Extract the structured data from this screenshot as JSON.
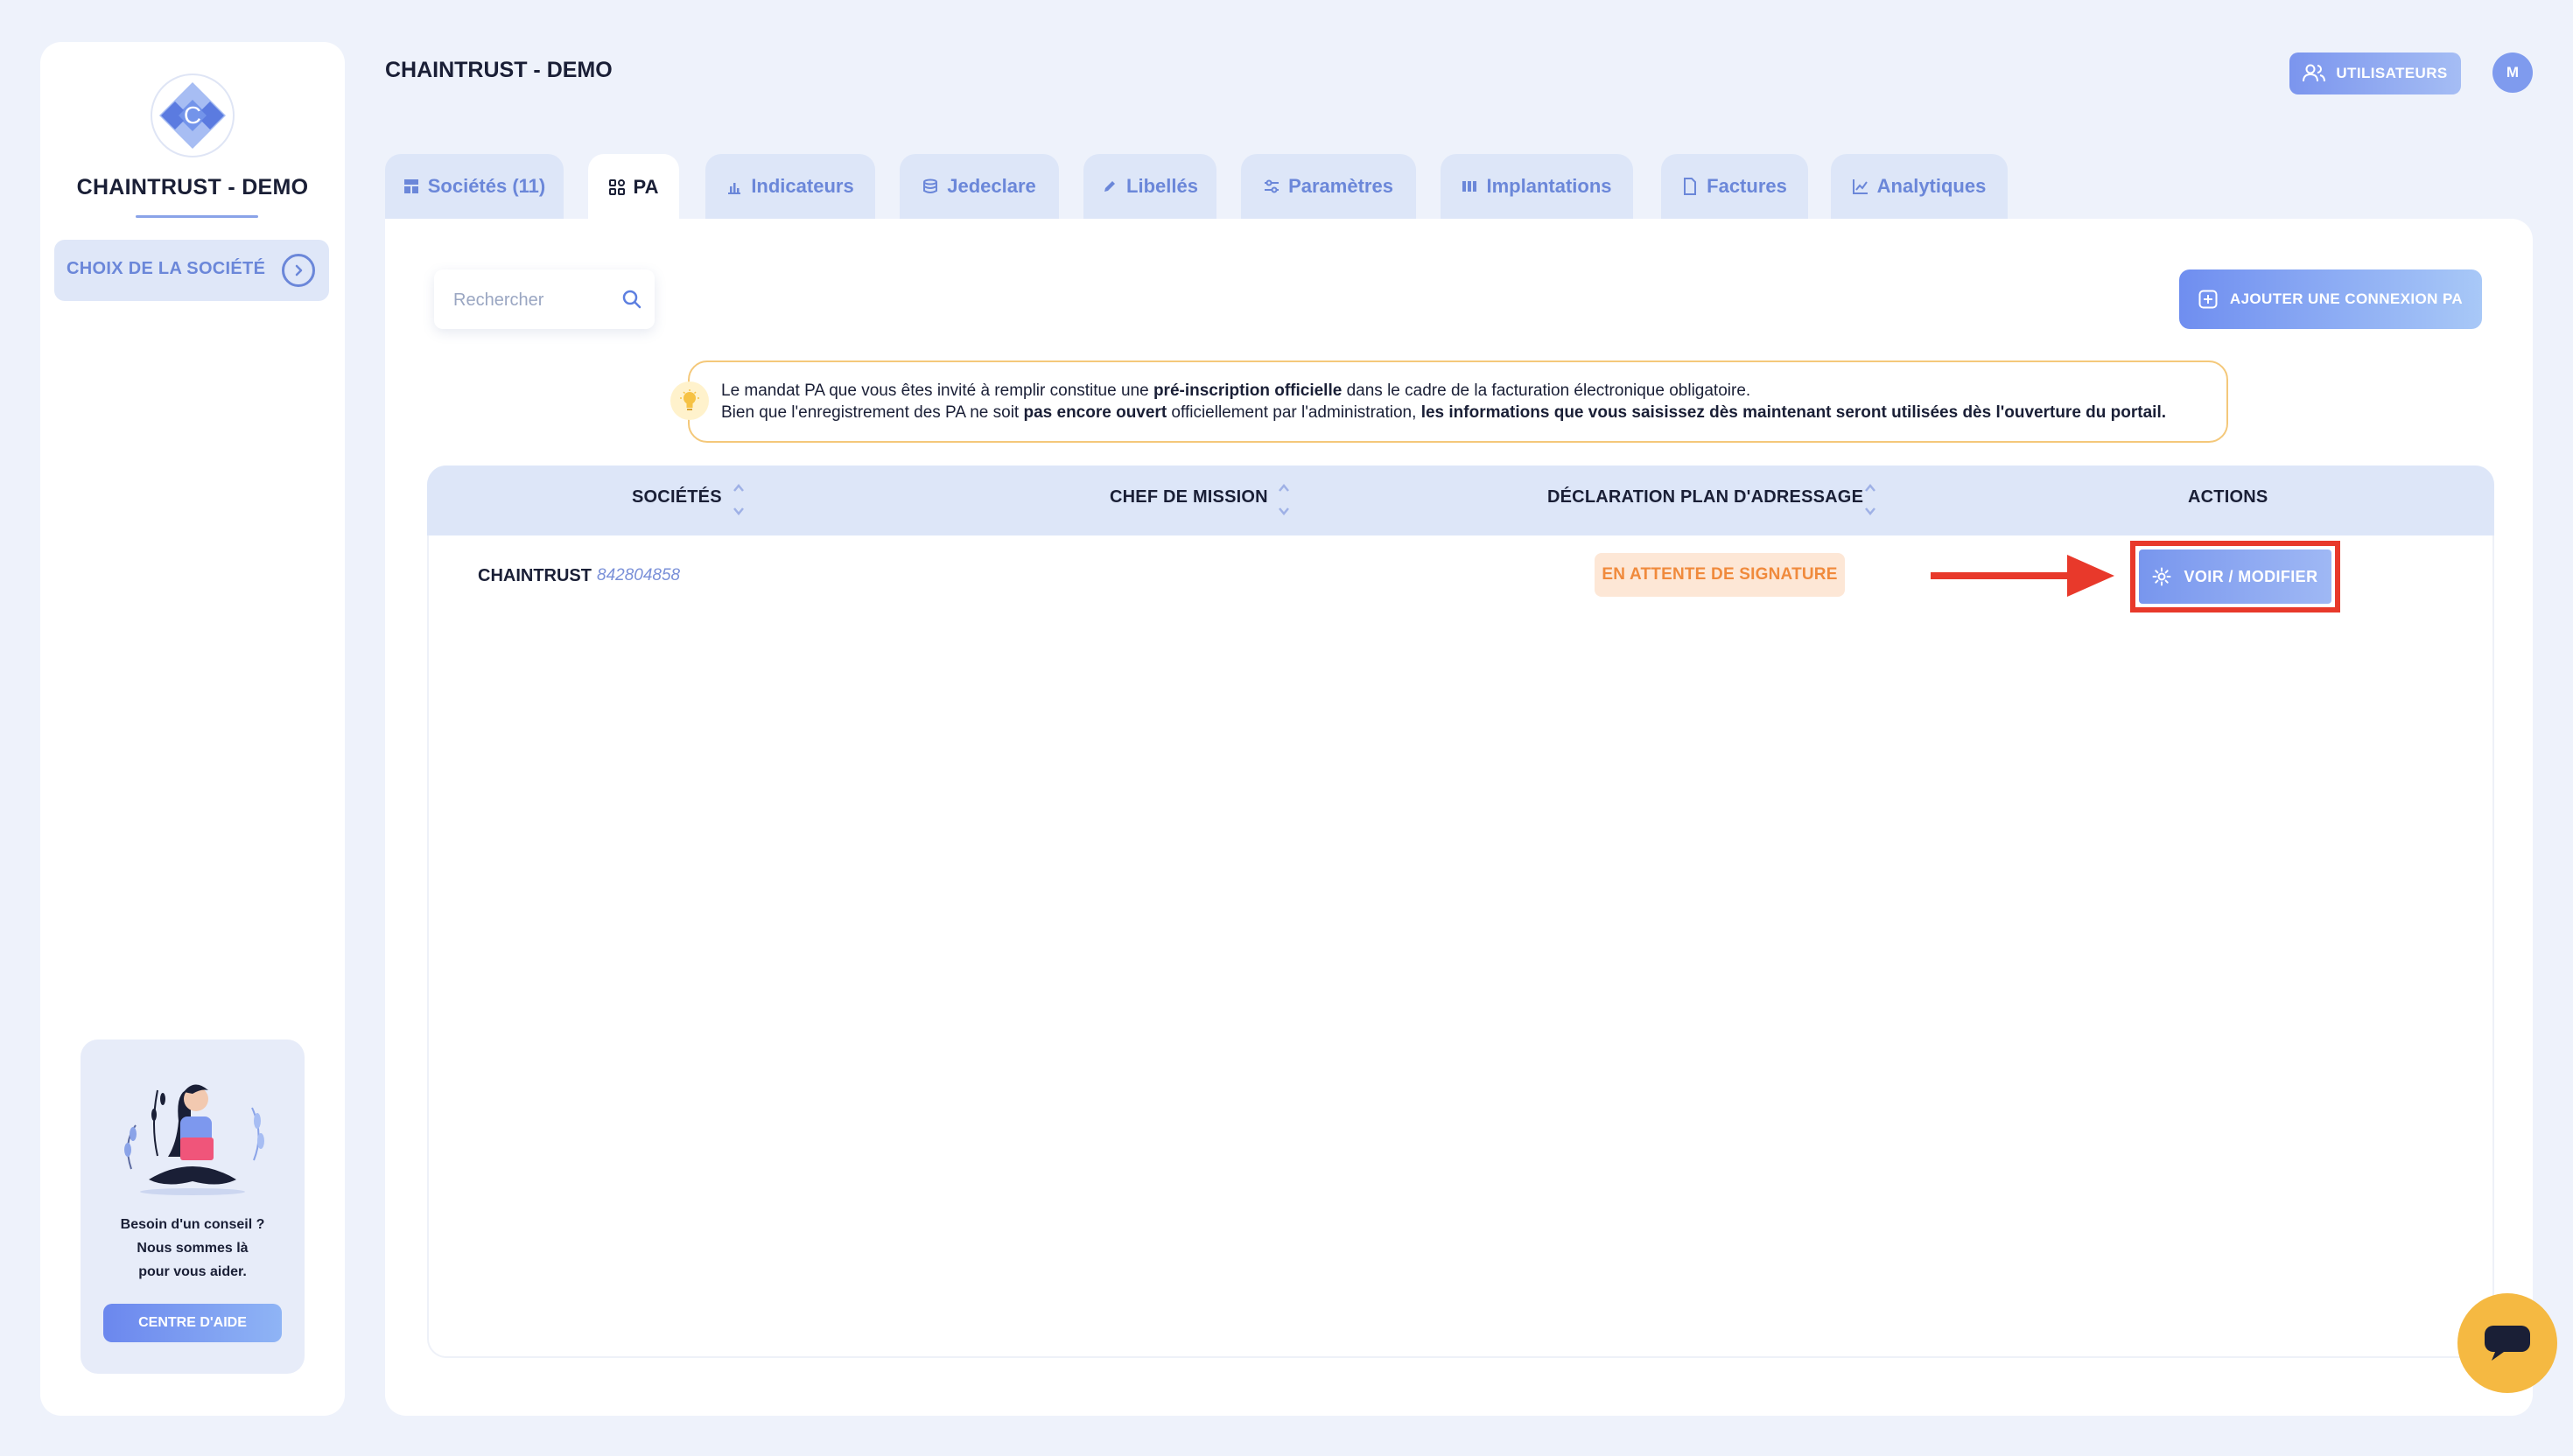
{
  "app": {
    "title": "CHAINTRUST - DEMO"
  },
  "sidebar": {
    "company_name": "CHAINTRUST - DEMO",
    "choice_label": "CHOIX DE LA SOCIÉTÉ",
    "help": {
      "line1": "Besoin d'un conseil ?",
      "line2": "Nous sommes là",
      "line3": "pour vous aider.",
      "button": "CENTRE D'AIDE"
    }
  },
  "header": {
    "users_button": "UTILISATEURS",
    "avatar_initial": "M"
  },
  "tabs": [
    {
      "label": "Sociétés (11)",
      "icon": "table-icon"
    },
    {
      "label": "PA",
      "icon": "grid-icon",
      "active": true
    },
    {
      "label": "Indicateurs",
      "icon": "bar-chart-icon"
    },
    {
      "label": "Jedeclare",
      "icon": "database-icon"
    },
    {
      "label": "Libellés",
      "icon": "pencil-icon"
    },
    {
      "label": "Paramètres",
      "icon": "sliders-icon"
    },
    {
      "label": "Implantations",
      "icon": "columns-icon"
    },
    {
      "label": "Factures",
      "icon": "file-icon"
    },
    {
      "label": "Analytiques",
      "icon": "line-chart-icon"
    }
  ],
  "search": {
    "placeholder": "Rechercher"
  },
  "add_button": "AJOUTER UNE CONNEXION PA",
  "notice": {
    "l1_a": "Le mandat PA que vous êtes invité à remplir constitue une ",
    "l1_b": "pré-inscription officielle",
    "l1_c": " dans le cadre de la facturation électronique obligatoire.",
    "l2_a": "Bien que l'enregistrement des PA ne soit ",
    "l2_b": "pas encore ouvert",
    "l2_c": " officiellement par l'administration, ",
    "l2_d": "les informations que vous saisissez dès maintenant seront utilisées dès l'ouverture du portail."
  },
  "table": {
    "columns": [
      "SOCIÉTÉS",
      "CHEF DE MISSION",
      "DÉCLARATION PLAN D'ADRESSAGE",
      "ACTIONS"
    ],
    "rows": [
      {
        "company": "CHAINTRUST",
        "siren": "842804858",
        "chef": "",
        "status": "EN ATTENTE DE SIGNATURE",
        "action": "VOIR / MODIFIER"
      }
    ]
  },
  "colors": {
    "accent": "#6b87d9",
    "status_pending": "#f08a3c",
    "highlight": "#e8392b",
    "chat": "#f5b942"
  }
}
